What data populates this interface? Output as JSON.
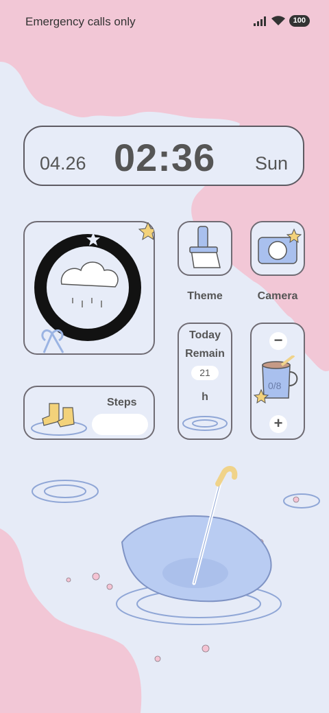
{
  "status_bar": {
    "carrier_text": "Emergency calls only",
    "battery_level": "100",
    "icons": [
      "signal-icon",
      "wifi-icon",
      "battery-icon"
    ]
  },
  "clock": {
    "date": "04.26",
    "time": "02:36",
    "day": "Sun"
  },
  "apps": [
    {
      "label": "Theme",
      "icon": "theme-brush-icon"
    },
    {
      "label": "Camera",
      "icon": "camera-icon"
    }
  ],
  "steps": {
    "label": "Steps"
  },
  "today_remain": {
    "line1": "Today",
    "line2": "Remain",
    "value": "21",
    "unit": "h"
  },
  "water": {
    "count": "0/8",
    "minus": "−",
    "plus": "+"
  },
  "colors": {
    "blossom": "#f2c7d6",
    "background": "#e6ebf7",
    "widget": "#e7ecf8",
    "outline": "#6f6b73",
    "umbrella": "#b9ccf2",
    "boot": "#f3d27a"
  }
}
